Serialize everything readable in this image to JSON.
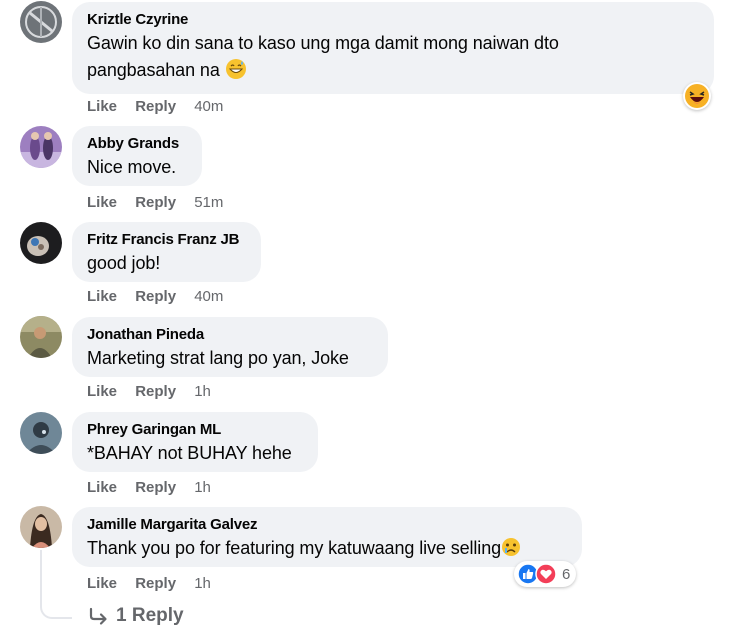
{
  "comments": [
    {
      "author": "Kriztle Czyrine",
      "text_line1": "Gawin ko din sana to kaso ung mga damit mong naiwan dto",
      "text_line2": "pangbasahan na",
      "like": "Like",
      "reply": "Reply",
      "time": "40m",
      "reaction": "haha-icon"
    },
    {
      "author": "Abby Grands",
      "text": "Nice move.",
      "like": "Like",
      "reply": "Reply",
      "time": "51m"
    },
    {
      "author": "Fritz Francis Franz JB",
      "text": "good job!",
      "like": "Like",
      "reply": "Reply",
      "time": "40m"
    },
    {
      "author": "Jonathan Pineda",
      "text": "Marketing strat lang po yan, Joke",
      "like": "Like",
      "reply": "Reply",
      "time": "1h"
    },
    {
      "author": "Phrey Garingan ML",
      "text": "*BAHAY not BUHAY hehe",
      "like": "Like",
      "reply": "Reply",
      "time": "1h"
    },
    {
      "author": "Jamille Margarita Galvez",
      "text": "Thank you po for featuring my katuwaang live selling",
      "like": "Like",
      "reply": "Reply",
      "time": "1h",
      "reaction_count": "6"
    }
  ],
  "replies_link": "1 Reply",
  "colors": {
    "bubble": "#f0f2f5",
    "muted": "#65676b",
    "like_blue": "#1877f2",
    "love_red": "#f33e58"
  }
}
